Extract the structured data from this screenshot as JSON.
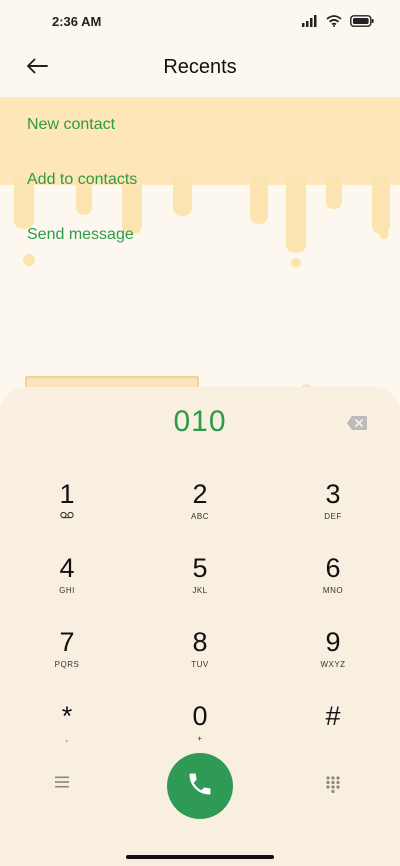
{
  "status_bar": {
    "time": "2:36 AM"
  },
  "header": {
    "title": "Recents"
  },
  "actions": [
    {
      "label": "New contact"
    },
    {
      "label": "Add to contacts"
    },
    {
      "label": "Send message"
    }
  ],
  "dialer": {
    "number": "010",
    "keys": [
      {
        "digit": "1",
        "letters": ""
      },
      {
        "digit": "2",
        "letters": "ABC"
      },
      {
        "digit": "3",
        "letters": "DEF"
      },
      {
        "digit": "4",
        "letters": "GHI"
      },
      {
        "digit": "5",
        "letters": "JKL"
      },
      {
        "digit": "6",
        "letters": "MNO"
      },
      {
        "digit": "7",
        "letters": "PQRS"
      },
      {
        "digit": "8",
        "letters": "TUV"
      },
      {
        "digit": "9",
        "letters": "WXYZ"
      },
      {
        "digit": "*",
        "letters": ","
      },
      {
        "digit": "0",
        "letters": "+"
      },
      {
        "digit": "#",
        "letters": ""
      }
    ]
  },
  "icons": {
    "signal": "signal-icon",
    "wifi": "wifi-icon",
    "battery": "battery-icon",
    "back": "back-arrow-icon",
    "backspace": "backspace-icon",
    "voicemail": "voicemail-icon",
    "menu": "menu-icon",
    "call": "phone-icon",
    "keypad": "dialpad-icon"
  },
  "colors": {
    "accent_green": "#2e9a47",
    "call_button": "#2e9a56",
    "background": "#fdf8ef",
    "dialer_panel": "#f8efe1",
    "drip_yellow": "#fde7b8"
  }
}
